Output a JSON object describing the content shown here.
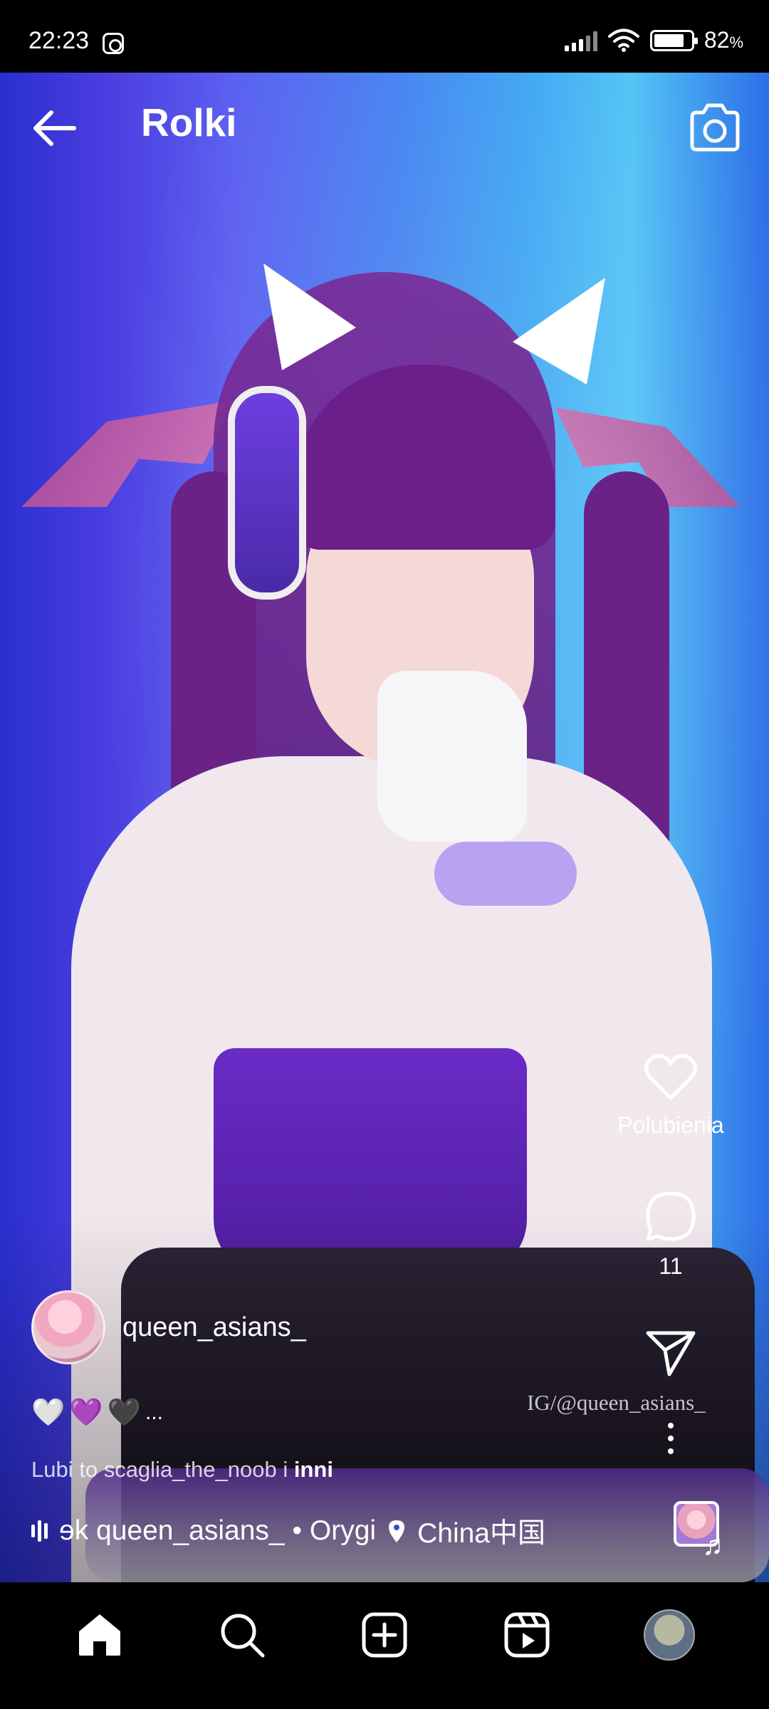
{
  "status_bar": {
    "time": "22:23",
    "battery_percent": "82",
    "battery_unit": "%",
    "battery_level": 0.82,
    "icons": [
      "instagram-icon",
      "signal-icon",
      "wifi-icon",
      "battery-icon"
    ]
  },
  "header": {
    "title": "Rolki",
    "back_icon": "arrow-left-icon",
    "camera_icon": "camera-icon"
  },
  "video": {
    "watermark": "IG/@queen_asians_"
  },
  "actions": {
    "like_label": "Polubienia",
    "comments_count": "11",
    "icons": [
      "heart-icon",
      "comment-icon",
      "share-icon",
      "more-icon"
    ]
  },
  "post": {
    "username": "queen_asians_",
    "caption_emojis": [
      "🤍",
      "💜",
      "🖤"
    ],
    "caption_more": "...",
    "liked_by_prefix": "Lubi to scaglia_the_noob i ",
    "liked_by_others": "inni",
    "audio_text": "ɘk  queen_asians_ • Orygi",
    "location": "China中国"
  },
  "bottom_nav": {
    "items": [
      "home-icon",
      "search-icon",
      "create-icon",
      "reels-icon",
      "profile-avatar"
    ]
  },
  "colors": {
    "background": "#000000",
    "text": "#ffffff",
    "video_blue": "#3f7ff0",
    "video_purple": "#5a1d7a"
  }
}
